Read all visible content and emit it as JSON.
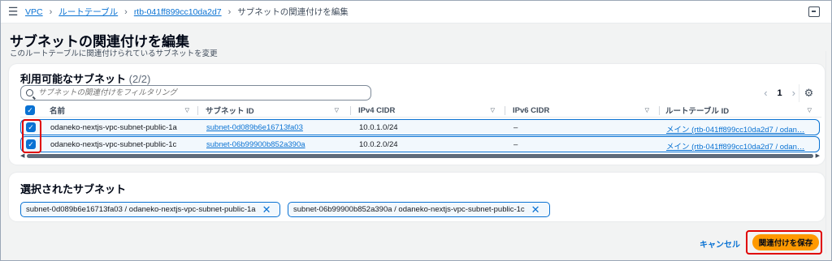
{
  "breadcrumb": {
    "items": [
      "VPC",
      "ルートテーブル",
      "rtb-041ff899cc10da2d7"
    ],
    "current": "サブネットの関連付けを編集"
  },
  "page": {
    "title": "サブネットの関連付けを編集",
    "description": "このルートテーブルに関連付けられているサブネットを変更"
  },
  "available": {
    "heading": "利用可能なサブネット",
    "count": "(2/2)",
    "filter_placeholder": "サブネットの関連付けをフィルタリング",
    "page_number": "1",
    "columns": [
      "名前",
      "サブネット ID",
      "IPv4 CIDR",
      "IPv6 CIDR",
      "ルートテーブル ID"
    ],
    "rows": [
      {
        "name": "odaneko-nextjs-vpc-subnet-public-1a",
        "subnet_id": "subnet-0d089b6e16713fa03",
        "ipv4": "10.0.1.0/24",
        "ipv6": "–",
        "route_table": "メイン (rtb-041ff899cc10da2d7 / odan…",
        "checked": true
      },
      {
        "name": "odaneko-nextjs-vpc-subnet-public-1c",
        "subnet_id": "subnet-06b99900b852a390a",
        "ipv4": "10.0.2.0/24",
        "ipv6": "–",
        "route_table": "メイン (rtb-041ff899cc10da2d7 / odan…",
        "checked": true
      }
    ]
  },
  "selected": {
    "heading": "選択されたサブネット",
    "tokens": [
      "subnet-0d089b6e16713fa03 / odaneko-nextjs-vpc-subnet-public-1a",
      "subnet-06b99900b852a390a / odaneko-nextjs-vpc-subnet-public-1c"
    ]
  },
  "actions": {
    "cancel": "キャンセル",
    "save": "関連付けを保存"
  },
  "colors": {
    "accent": "#0972d3",
    "save_button": "#ff9900",
    "highlight": "#e00000"
  }
}
